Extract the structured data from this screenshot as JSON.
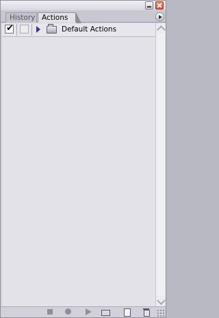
{
  "tabs": {
    "history": "History",
    "actions": "Actions"
  },
  "actions_list": {
    "rows": [
      {
        "checked": true,
        "check_glyph": "✔",
        "label": "Default Actions"
      }
    ]
  },
  "icons": {
    "minimize": "minimize-icon",
    "close": "close-icon",
    "panel_menu": "panel-menu-arrow-icon",
    "expand": "expand-triangle-icon",
    "folder": "folder-icon",
    "stop": "stop-icon",
    "record": "record-icon",
    "play": "play-icon",
    "new_set": "new-set-icon",
    "new_action": "new-action-icon",
    "delete": "trash-icon"
  },
  "colors": {
    "close_button": "#d9502c",
    "expand_triangle": "#3a2fa0",
    "panel_bg": "#d4d3dc",
    "list_bg": "#e3e2e8"
  }
}
